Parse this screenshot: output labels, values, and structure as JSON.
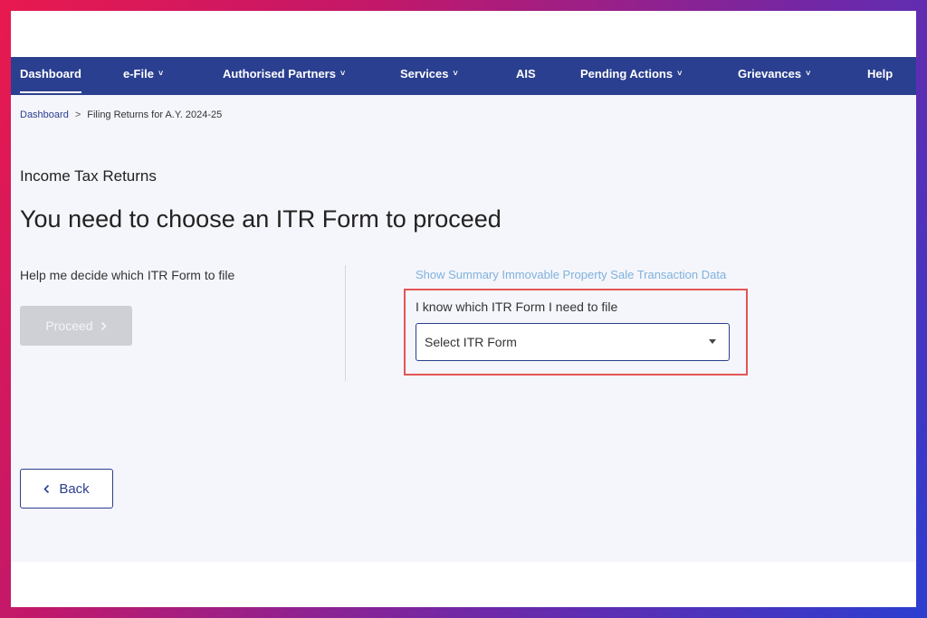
{
  "nav": {
    "items": [
      {
        "label": "Dashboard",
        "has_menu": false
      },
      {
        "label": "e-File",
        "has_menu": true
      },
      {
        "label": "Authorised Partners",
        "has_menu": true
      },
      {
        "label": "Services",
        "has_menu": true
      },
      {
        "label": "AIS",
        "has_menu": false
      },
      {
        "label": "Pending Actions",
        "has_menu": true
      },
      {
        "label": "Grievances",
        "has_menu": true
      },
      {
        "label": "Help",
        "has_menu": false
      }
    ],
    "active": "Dashboard",
    "chevron": "˅"
  },
  "breadcrumb": {
    "home": "Dashboard",
    "current": "Filing Returns for A.Y. 2024-25",
    "separator": ">"
  },
  "section_title": "Income Tax Returns",
  "page_title": "You need to choose an ITR Form to proceed",
  "left_panel": {
    "help_text": "Help me decide which ITR Form to file",
    "proceed_label": "Proceed"
  },
  "right_panel": {
    "summary_link": "Show Summary Immovable Property Sale Transaction Data",
    "know_label": "I know which ITR Form I need to file",
    "select_value": "Select ITR Form"
  },
  "back_label": "Back",
  "colors": {
    "nav_bg": "#2a3f8f",
    "content_bg": "#f5f6fb",
    "highlight": "#e25555",
    "link": "#7fb2dd",
    "disabled_btn": "#cfd0d6"
  }
}
